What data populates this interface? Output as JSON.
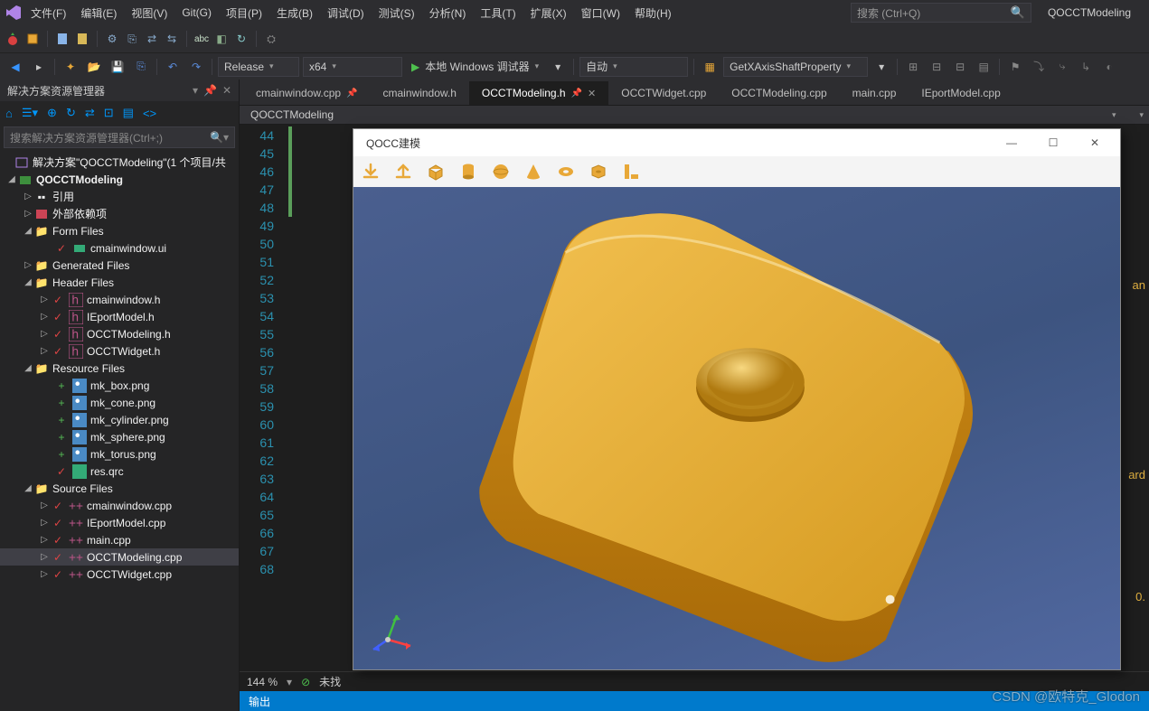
{
  "menu": {
    "file": "文件(F)",
    "edit": "编辑(E)",
    "view": "视图(V)",
    "git": "Git(G)",
    "project": "项目(P)",
    "build": "生成(B)",
    "debug": "调试(D)",
    "test": "测试(S)",
    "analyze": "分析(N)",
    "tools": "工具(T)",
    "extensions": "扩展(X)",
    "window": "窗口(W)",
    "help": "帮助(H)"
  },
  "search_placeholder": "搜索 (Ctrl+Q)",
  "project_name": "QOCCTModeling",
  "toolbar2": {
    "config": "Release",
    "platform": "x64",
    "debug": "本地 Windows 调试器",
    "auto": "自动",
    "func": "GetXAxisShaftProperty"
  },
  "solution_panel": {
    "title": "解决方案资源管理器",
    "search": "搜索解决方案资源管理器(Ctrl+;)",
    "root": "解决方案\"QOCCTModeling\"(1 个项目/共",
    "project": "QOCCTModeling",
    "refs": "引用",
    "ext": "外部依赖项",
    "form": "Form Files",
    "form1": "cmainwindow.ui",
    "gen": "Generated Files",
    "hdr": "Header Files",
    "h1": "cmainwindow.h",
    "h2": "IEportModel.h",
    "h3": "OCCTModeling.h",
    "h4": "OCCTWidget.h",
    "res": "Resource Files",
    "r1": "mk_box.png",
    "r2": "mk_cone.png",
    "r3": "mk_cylinder.png",
    "r4": "mk_sphere.png",
    "r5": "mk_torus.png",
    "r6": "res.qrc",
    "src": "Source Files",
    "s1": "cmainwindow.cpp",
    "s2": "IEportModel.cpp",
    "s3": "main.cpp",
    "s4": "OCCTModeling.cpp",
    "s5": "OCCTWidget.cpp"
  },
  "tabs": {
    "t1": "cmainwindow.cpp",
    "t2": "cmainwindow.h",
    "t3": "OCCTModeling.h",
    "t4": "OCCTWidget.cpp",
    "t5": "OCCTModeling.cpp",
    "t6": "main.cpp",
    "t7": "IEportModel.cpp"
  },
  "crumb": "QOCCTModeling",
  "line_start": 44,
  "line_end": 68,
  "zoom": "144 %",
  "status_ok": "未找",
  "output": "输出",
  "qocc": {
    "title": "QOCC建模",
    "icons": [
      "download-icon",
      "upload-icon",
      "box-icon",
      "cylinder-icon",
      "sphere-icon",
      "cone-icon",
      "torus-icon",
      "shape-icon",
      "ruler-icon"
    ]
  },
  "watermark": "CSDN @欧特克_Glodon",
  "peek": {
    "a": "an",
    "b": "ard",
    "c": "0."
  }
}
